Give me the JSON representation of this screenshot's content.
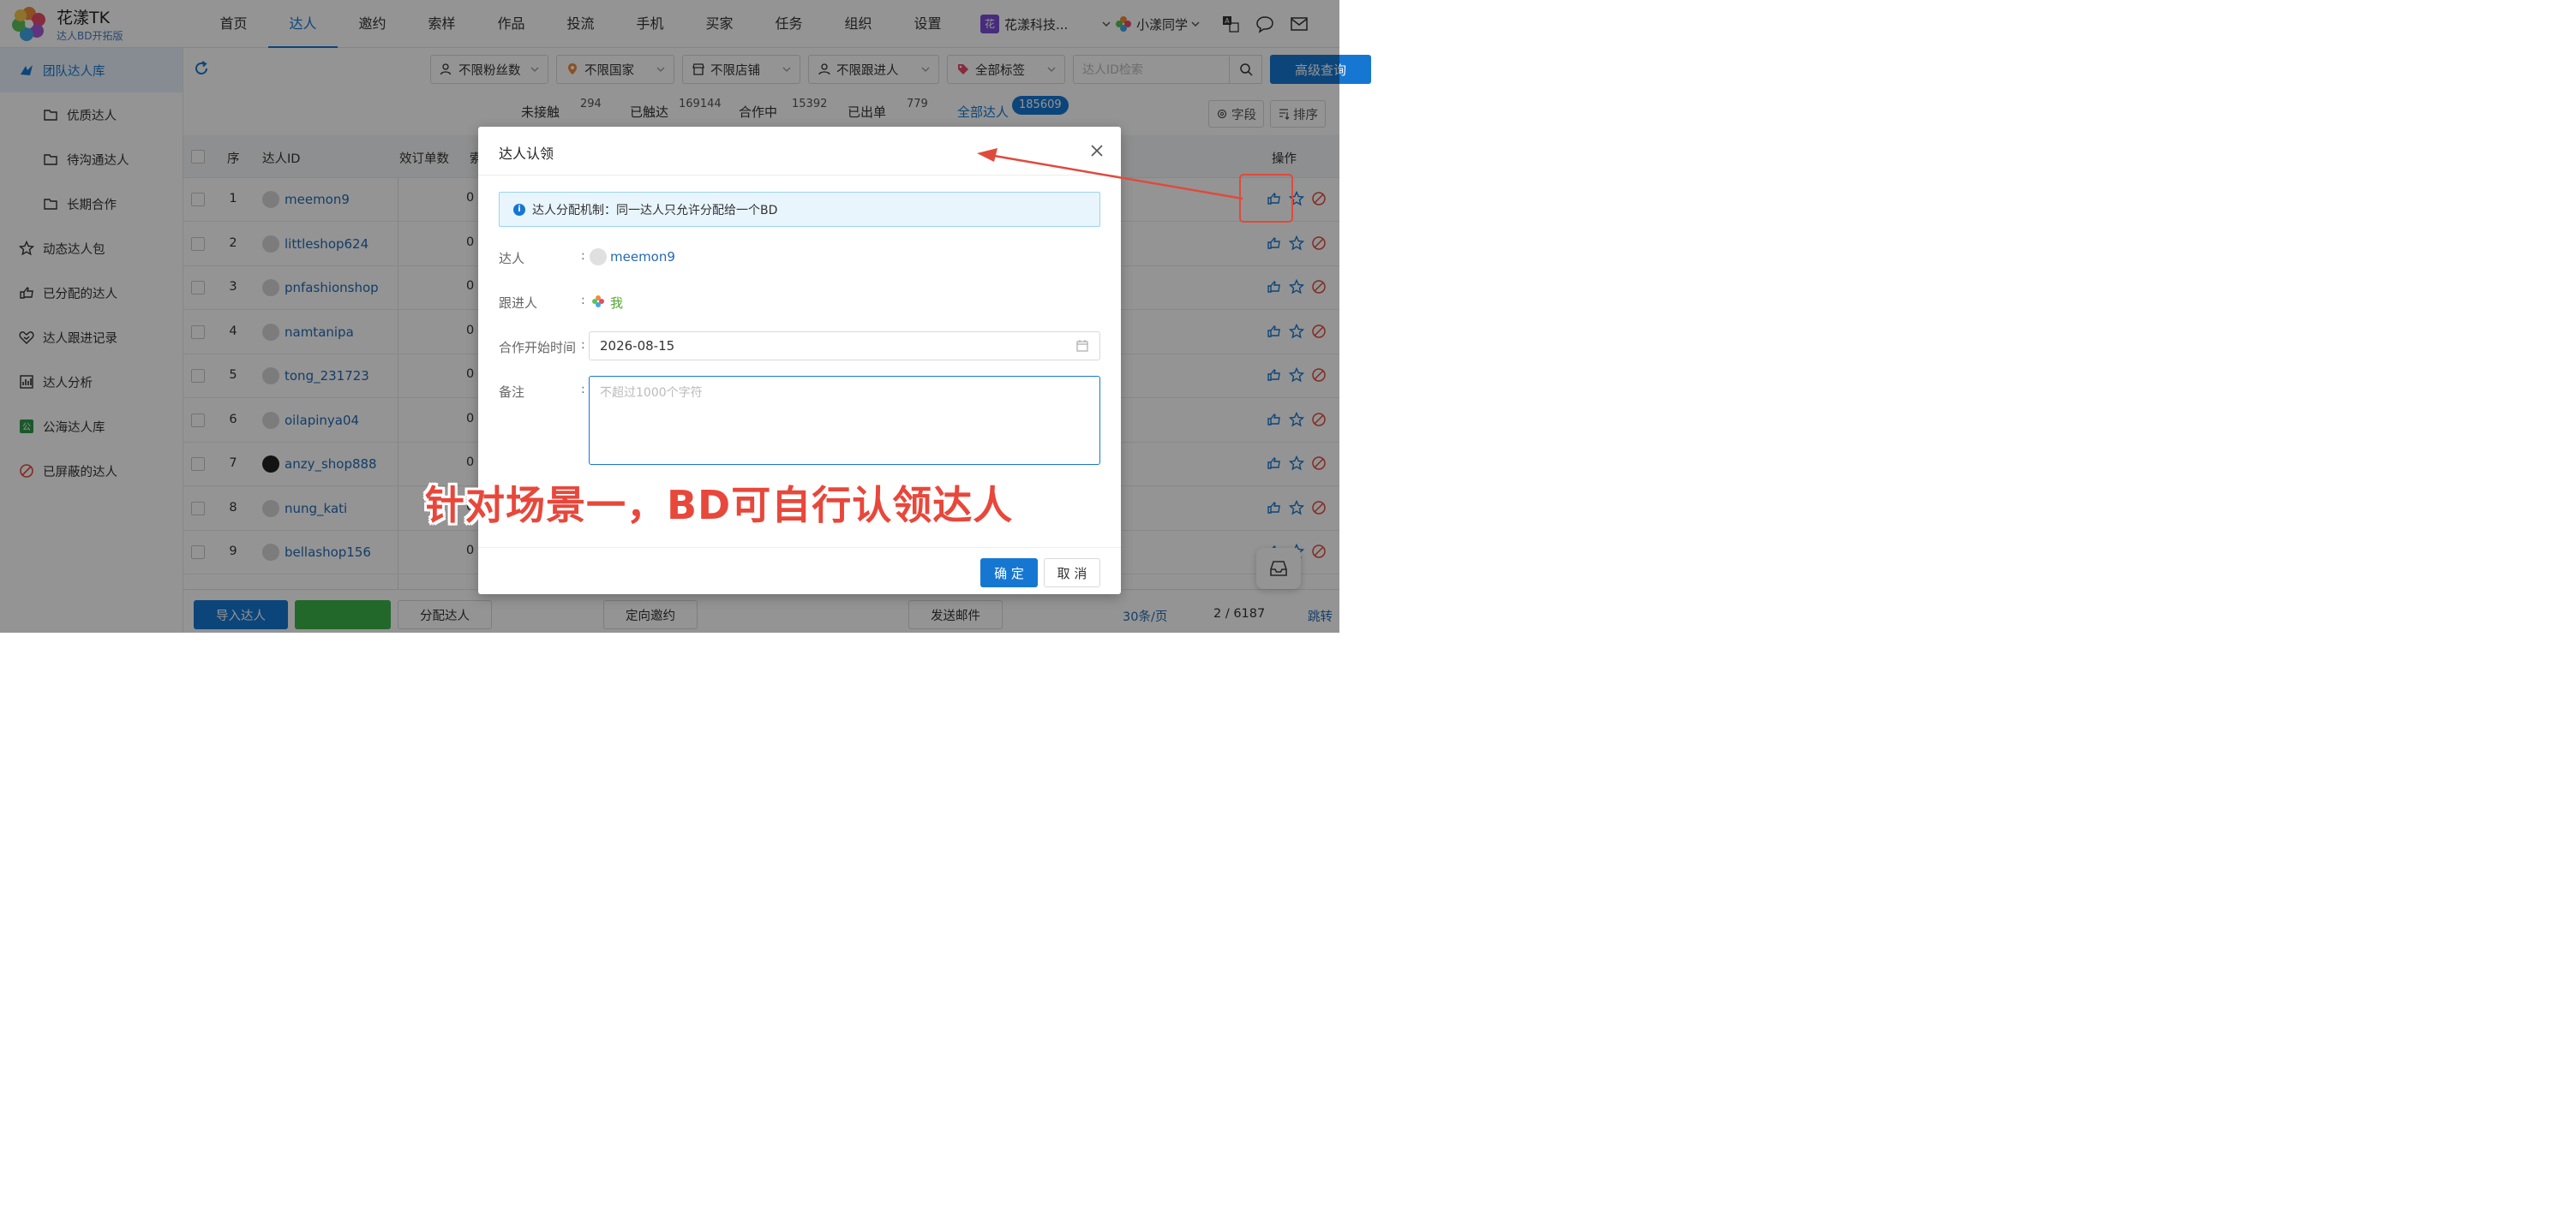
{
  "brand": {
    "name": "花漾TK",
    "subtitle": "达人BD开拓版"
  },
  "nav": {
    "items": [
      "首页",
      "达人",
      "邀约",
      "索样",
      "作品",
      "投流",
      "手机",
      "买家",
      "任务",
      "组织",
      "设置"
    ],
    "active_index": 1
  },
  "org": {
    "badge": "花",
    "name": "花漾科技..."
  },
  "user": {
    "name": "小漾同学"
  },
  "sidebar": {
    "items": [
      {
        "label": "团队达人库",
        "icon": "team-library-icon",
        "active": true
      },
      {
        "label": "优质达人",
        "icon": "folder-icon",
        "sub": true
      },
      {
        "label": "待沟通达人",
        "icon": "folder-icon",
        "sub": true
      },
      {
        "label": "长期合作",
        "icon": "folder-icon",
        "sub": true
      },
      {
        "label": "动态达人包",
        "icon": "star-icon"
      },
      {
        "label": "已分配的达人",
        "icon": "assign-hand-icon"
      },
      {
        "label": "达人跟进记录",
        "icon": "heart-handshake-icon"
      },
      {
        "label": "达人分析",
        "icon": "chart-icon"
      },
      {
        "label": "公海达人库",
        "icon": "public-pool-icon"
      },
      {
        "label": "已屏蔽的达人",
        "icon": "block-icon"
      }
    ]
  },
  "filters": {
    "fans": "不限粉丝数",
    "country": "不限国家",
    "shop": "不限店铺",
    "follower": "不限跟进人",
    "tags": "全部标签",
    "search_placeholder": "达人ID检索",
    "advanced": "高级查询"
  },
  "stats": {
    "untouched_label": "未接触",
    "untouched_count": "294",
    "touched_label": "已触达",
    "touched_count": "169144",
    "cooperating_label": "合作中",
    "cooperating_count": "15392",
    "ordered_label": "已出单",
    "ordered_count": "779",
    "all_label": "全部达人",
    "all_count": "185609",
    "fields_btn": "字段",
    "sort_btn": "排序"
  },
  "table": {
    "headers": {
      "seq": "序",
      "id": "达人ID",
      "orders": "效订单数",
      "sample": "索",
      "ops": "操作"
    },
    "rows": [
      {
        "seq": "1",
        "id": "meemon9",
        "orders": "0"
      },
      {
        "seq": "2",
        "id": "littleshop624",
        "orders": "0"
      },
      {
        "seq": "3",
        "id": "pnfashionshop",
        "orders": "0"
      },
      {
        "seq": "4",
        "id": "namtanipa",
        "orders": "0"
      },
      {
        "seq": "5",
        "id": "tong_231723",
        "orders": "0"
      },
      {
        "seq": "6",
        "id": "oilapinya04",
        "orders": "0"
      },
      {
        "seq": "7",
        "id": "anzy_shop888",
        "orders": "0"
      },
      {
        "seq": "8",
        "id": "nung_kati",
        "orders": "0"
      },
      {
        "seq": "9",
        "id": "bellashop156",
        "orders": "0"
      }
    ]
  },
  "bottom": {
    "import": "导入达人",
    "assign": "分配达人",
    "invite": "定向邀约",
    "email": "发送邮件",
    "page_size": "30条/页",
    "page": "2 / 6187",
    "jump": "跳转"
  },
  "modal": {
    "title": "达人认领",
    "info": "达人分配机制：同一达人只允许分配给一个BD",
    "creator_label": "达人",
    "creator_value": "meemon9",
    "follower_label": "跟进人",
    "follower_value": "我",
    "start_label": "合作开始时间",
    "start_value": "2026-08-15",
    "note_label": "备注",
    "note_placeholder": "不超过1000个字符",
    "colon": ":",
    "ok": "确 定",
    "cancel": "取 消"
  },
  "annotation": {
    "caption": "针对场景一，BD可自行认领达人",
    "color": "#e8473b"
  },
  "colors": {
    "primary": "#1677d2",
    "link": "#2469b3",
    "success": "#52a82f"
  }
}
